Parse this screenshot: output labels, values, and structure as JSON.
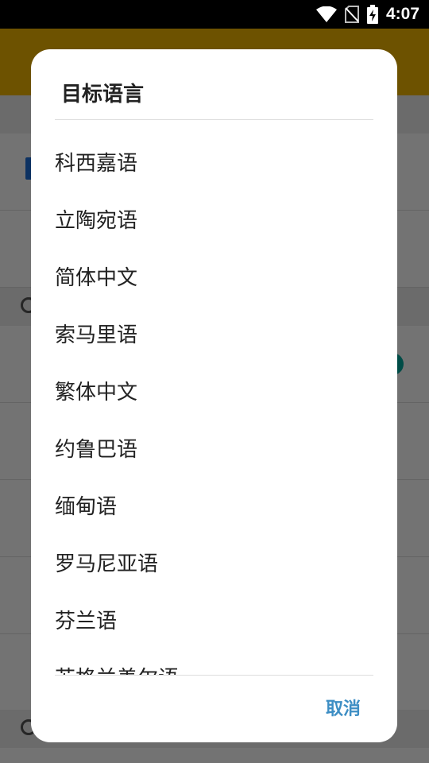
{
  "status_bar": {
    "time": "4:07",
    "icons": [
      "wifi-icon",
      "no-sim-icon",
      "battery-charging-icon"
    ]
  },
  "dialog": {
    "title": "目标语言",
    "options": [
      "科西嘉语",
      "立陶宛语",
      "简体中文",
      "索马里语",
      "繁体中文",
      "约鲁巴语",
      "缅甸语",
      "罗马尼亚语",
      "芬兰语",
      "苏格兰盖尔语"
    ],
    "cancel_label": "取消"
  },
  "colors": {
    "accent": "#3d8ec4",
    "toolbar": "#f2b600"
  }
}
